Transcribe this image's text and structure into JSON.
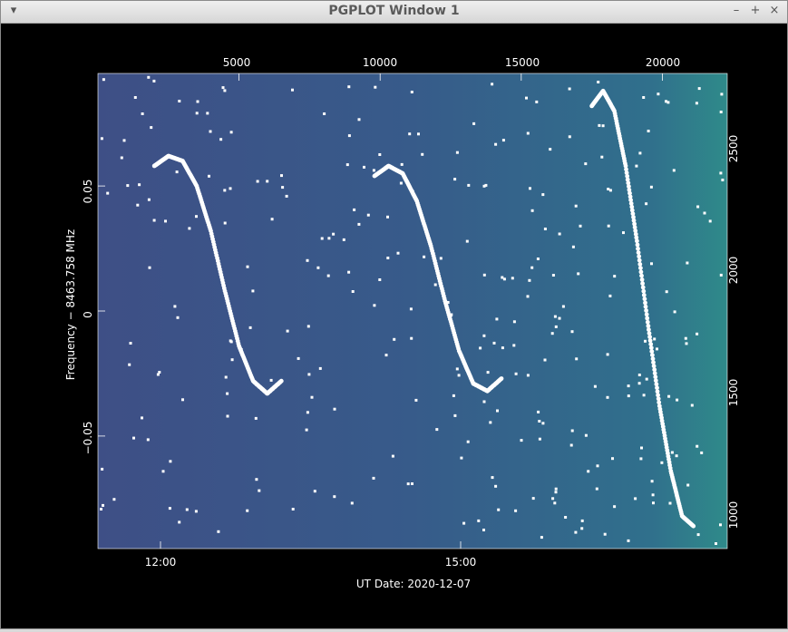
{
  "window": {
    "title": "PGPLOT Window 1",
    "menu_icon": "triangle-down-icon",
    "buttons": {
      "minimize": "–",
      "maximize": "+",
      "close": "×"
    }
  },
  "colors": {
    "background": "#000000",
    "plot_left": "#3e4f86",
    "plot_mid": "#375b8a",
    "plot_right": "#2f8a8a",
    "points": "#ffffff",
    "text": "#ffffff"
  },
  "chart_data": {
    "type": "scatter",
    "subtitle": "",
    "title": "",
    "xlabel": "UT Date: 2020-12-07",
    "ylabel": "Frequency − 8463.758 MHz",
    "bottom_ticks": [
      "12:00",
      "15:00"
    ],
    "top_ticks": [
      "5000",
      "10000",
      "15000",
      "20000"
    ],
    "left_ticks": [
      "0.05",
      "0",
      "−0.05"
    ],
    "right_ticks": [
      "2500",
      "2000",
      "1500",
      "1000"
    ],
    "x_unit": "seconds",
    "xlim": [
      0,
      22300
    ],
    "ylim": [
      -0.095,
      0.095
    ],
    "right_ylim": [
      900,
      2850
    ],
    "background": "noise image (teal increasing toward right)",
    "series": [
      {
        "name": "",
        "points": [
          [
            2000,
            0.058
          ],
          [
            2500,
            0.062
          ],
          [
            3000,
            0.06
          ],
          [
            3500,
            0.05
          ],
          [
            4000,
            0.032
          ],
          [
            4500,
            0.008
          ],
          [
            5000,
            -0.014
          ],
          [
            5500,
            -0.028
          ],
          [
            6000,
            -0.033
          ],
          [
            6500,
            -0.028
          ]
        ]
      },
      {
        "name": "",
        "points": [
          [
            9800,
            0.054
          ],
          [
            10300,
            0.058
          ],
          [
            10800,
            0.055
          ],
          [
            11300,
            0.044
          ],
          [
            11800,
            0.026
          ],
          [
            12300,
            0.004
          ],
          [
            12800,
            -0.016
          ],
          [
            13300,
            -0.029
          ],
          [
            13800,
            -0.032
          ],
          [
            14300,
            -0.027
          ]
        ]
      },
      {
        "name": "",
        "points": [
          [
            17500,
            0.082
          ],
          [
            17900,
            0.088
          ],
          [
            18300,
            0.08
          ],
          [
            18700,
            0.058
          ],
          [
            19100,
            0.028
          ],
          [
            19500,
            -0.006
          ],
          [
            19900,
            -0.038
          ],
          [
            20300,
            -0.064
          ],
          [
            20700,
            -0.082
          ],
          [
            21100,
            -0.086
          ]
        ]
      }
    ]
  }
}
